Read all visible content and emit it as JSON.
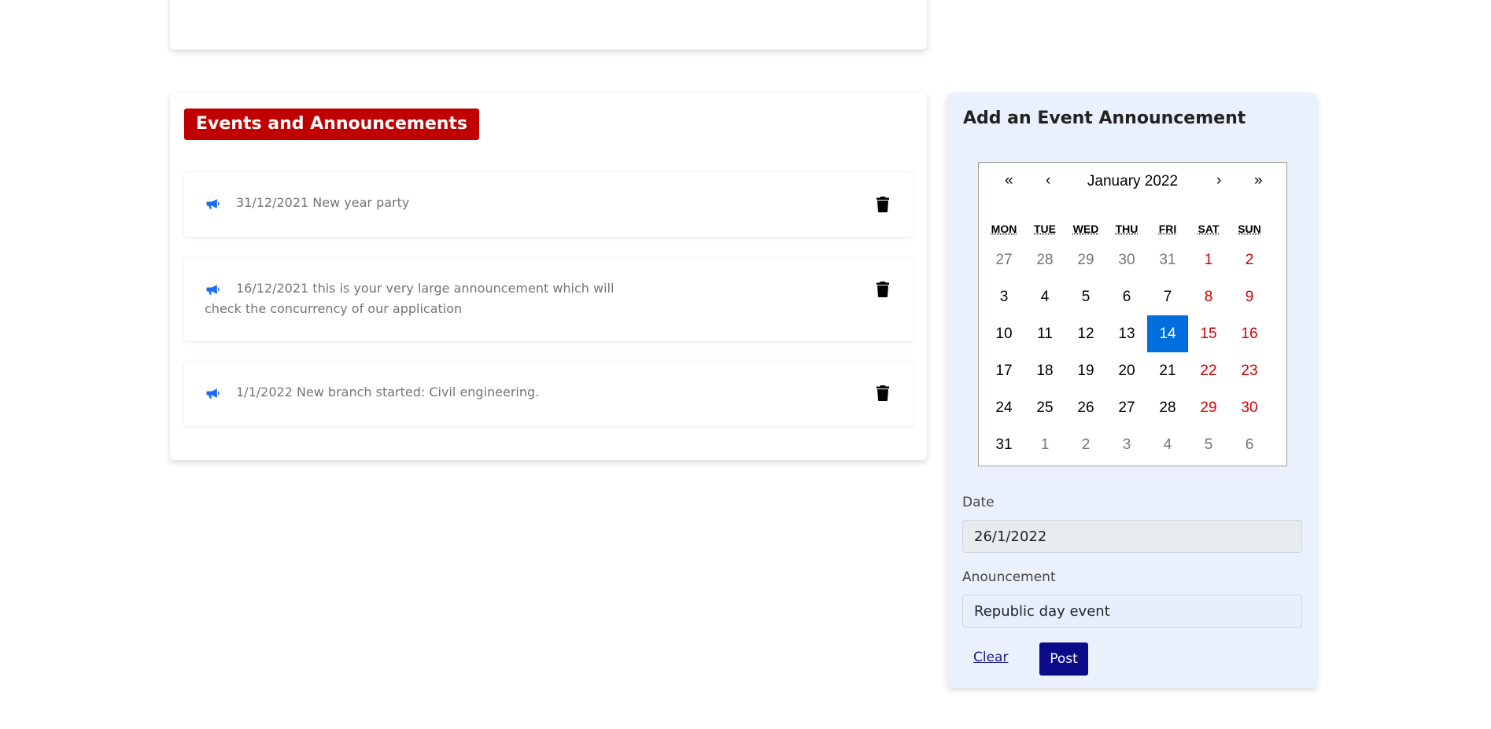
{
  "events": {
    "title": "Events and Announcements",
    "items": [
      {
        "text": "31/12/2021 New year party",
        "icon": "megaphone-icon",
        "delete_icon": "trash-icon"
      },
      {
        "text": "16/12/2021 this is your very large announcement which will check the concurrency of our application",
        "icon": "megaphone-icon",
        "delete_icon": "trash-icon"
      },
      {
        "text": "1/1/2022 New branch started: Civil engineering.",
        "icon": "megaphone-icon",
        "delete_icon": "trash-icon"
      }
    ]
  },
  "add_event": {
    "title": "Add an Event Announcement",
    "calendar": {
      "prev2": "«",
      "prev": "‹",
      "label": "January 2022",
      "next": "›",
      "next2": "»",
      "weekdays": [
        "MON",
        "TUE",
        "WED",
        "THU",
        "FRI",
        "SAT",
        "SUN"
      ],
      "weeks": [
        [
          "27",
          "28",
          "29",
          "30",
          "31",
          "1",
          "2"
        ],
        [
          "3",
          "4",
          "5",
          "6",
          "7",
          "8",
          "9"
        ],
        [
          "10",
          "11",
          "12",
          "13",
          "14",
          "15",
          "16"
        ],
        [
          "17",
          "18",
          "19",
          "20",
          "21",
          "22",
          "23"
        ],
        [
          "24",
          "25",
          "26",
          "27",
          "28",
          "29",
          "30"
        ],
        [
          "31",
          "1",
          "2",
          "3",
          "4",
          "5",
          "6"
        ]
      ],
      "selected_day": "14"
    },
    "date_label": "Date",
    "date_value": "26/1/2022",
    "announcement_label": "Anouncement",
    "announcement_value": "Republic day event",
    "clear_label": "Clear",
    "post_label": "Post"
  },
  "colors": {
    "title_badge": "#c00000",
    "icon_blue": "#1a6cf5",
    "panel_bg": "#ebf1fc",
    "selected_day": "#006edc",
    "weekend": "#d10000",
    "post_button": "#0a0a8a"
  }
}
